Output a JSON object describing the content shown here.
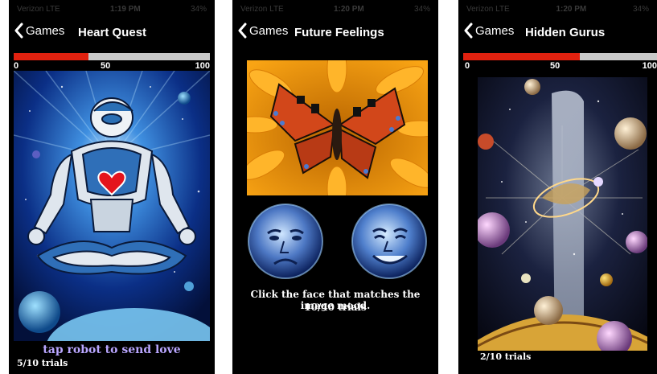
{
  "colors": {
    "progress_fill": "#e0210f",
    "progress_track": "#c9c9c9",
    "screen_bg": "#000000",
    "caption_purple": "#b9a6ff"
  },
  "progress_scale": [
    "0",
    "50",
    "100"
  ],
  "screens": [
    {
      "status": {
        "carrier": "Verizon LTE",
        "time": "1:19 PM",
        "battery": "34%"
      },
      "back_label": "Games",
      "title": "Heart Quest",
      "progress": 0.38,
      "caption": "tap robot to send love",
      "trials": "5/10 trials",
      "image": "meditating-robot-with-heart"
    },
    {
      "status": {
        "carrier": "Verizon LTE",
        "time": "1:20 PM",
        "battery": "34%"
      },
      "back_label": "Games",
      "title": "Future Feelings",
      "caption": "Click the face that matches the image mood.",
      "trials": "10/40 trials",
      "image": "butterfly-on-sunflower",
      "faces": [
        "sad-face",
        "happy-face"
      ]
    },
    {
      "status": {
        "carrier": "Verizon LTE",
        "time": "1:20 PM",
        "battery": "34%"
      },
      "back_label": "Games",
      "title": "Hidden Gurus",
      "progress": 0.6,
      "trials": "2/10 trials",
      "image": "cosmic-planets-scene"
    }
  ]
}
